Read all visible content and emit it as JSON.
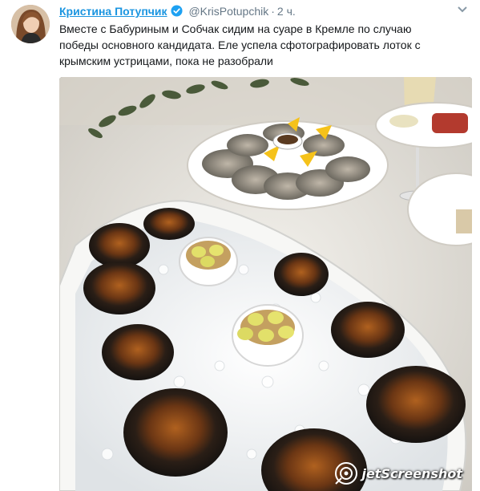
{
  "tweet": {
    "display_name": "Кристина Потупчик",
    "handle": "@KrisPotupchik",
    "separator": "·",
    "time": "2 ч.",
    "text": "Вместе с Бабуриным и Собчак сидим на суаре в Кремле по случаю победы основного кандидата. Еле успела сфотографировать лоток с крымским устрицами, пока не разобрали"
  },
  "icons": {
    "verified": "verified-badge-icon",
    "menu": "chevron-down-icon",
    "watermark": "jetscreenshot-logo-icon"
  },
  "watermark": {
    "text": "jetScreenshot"
  },
  "colors": {
    "name_link": "#1b95e0",
    "meta_gray": "#657786",
    "text": "#14171a"
  }
}
